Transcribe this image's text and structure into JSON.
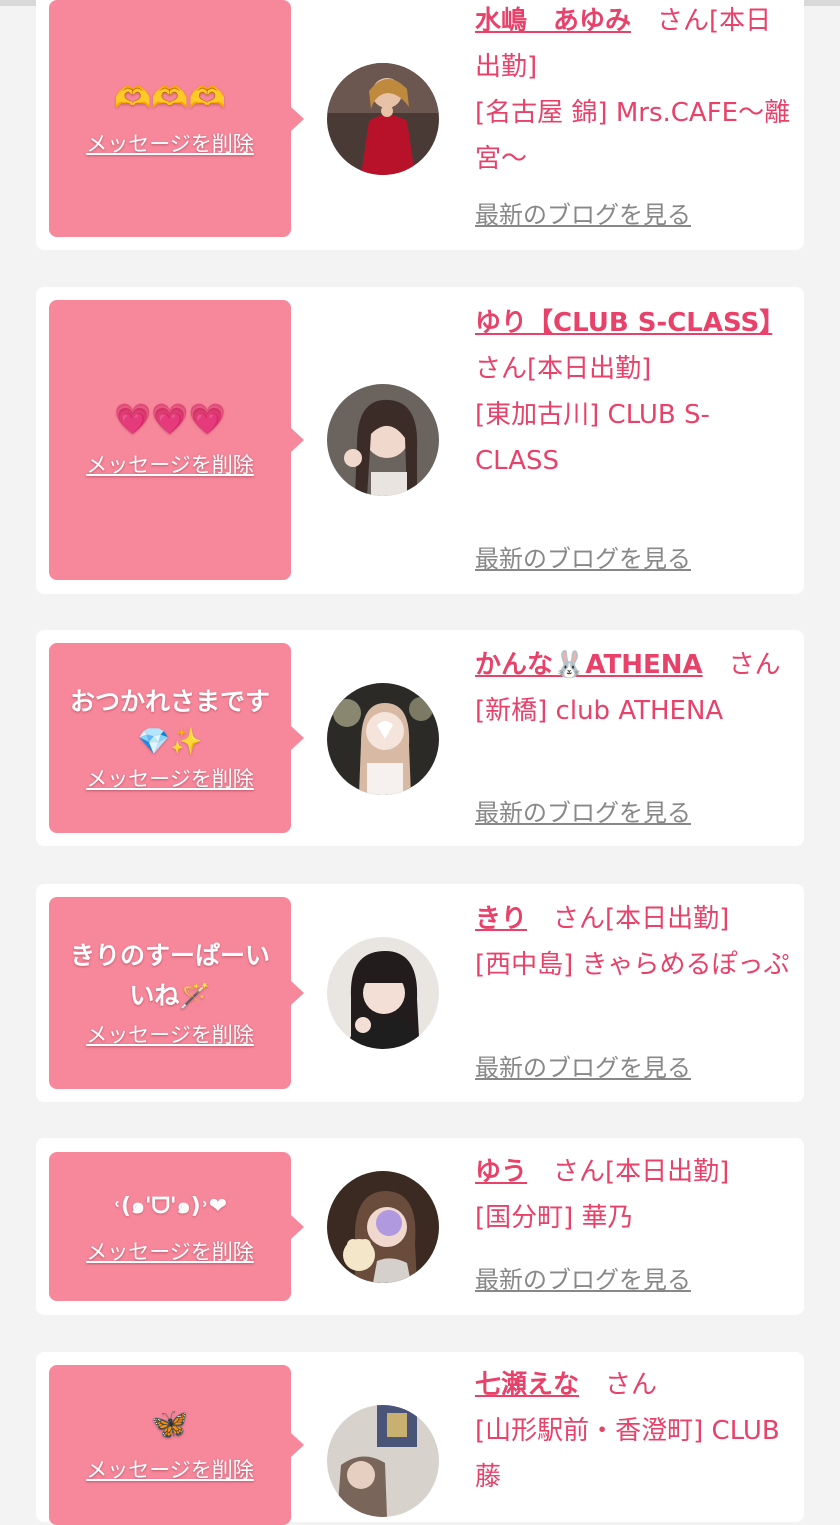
{
  "delete_label": "メッセージを削除",
  "blog_label": "最新のブログを見る",
  "colors": {
    "bubble": "#f7879a",
    "accent": "#e8416a",
    "link_gray": "#888888",
    "page_bg": "#f3f3f3"
  },
  "cards": [
    {
      "message": "",
      "message_emoji": "🫶🫶🫶",
      "name": "水嶋　あゆみ",
      "suffix": "　さん[本日出勤]",
      "shop": "[名古屋 錦] Mrs.CAFE〜離宮〜",
      "avatar_icon": "profile-photo"
    },
    {
      "message": "",
      "message_emoji": "💗💗💗",
      "name": "ゆり【CLUB S-CLASS】",
      "suffix": "　さん[本日出勤]",
      "shop": "[東加古川] CLUB S-CLASS",
      "avatar_icon": "profile-photo"
    },
    {
      "message": "おつかれさまです",
      "message_emoji": "💎✨",
      "name": "かんな🐰ATHENA",
      "suffix": "　さん",
      "shop": "[新橋] club ATHENA",
      "avatar_icon": "profile-photo"
    },
    {
      "message": "きりのすーぱーいいね🪄",
      "message_emoji": "",
      "name": "きり",
      "suffix": "　さん[本日出勤]",
      "shop": "[西中島] きゃらめるぽっぷ",
      "avatar_icon": "profile-photo"
    },
    {
      "message": "",
      "message_emoji": "˓(๑'ᗜ'๑)˒❤︎",
      "name": "ゆう",
      "suffix": "　さん[本日出勤]",
      "shop": "[国分町] 華乃",
      "avatar_icon": "profile-photo"
    },
    {
      "message": "",
      "message_emoji": "🦋",
      "name": "七瀬えな",
      "suffix": "　さん",
      "shop": "[山形駅前・香澄町] CLUB 藤",
      "avatar_icon": "profile-photo"
    }
  ]
}
